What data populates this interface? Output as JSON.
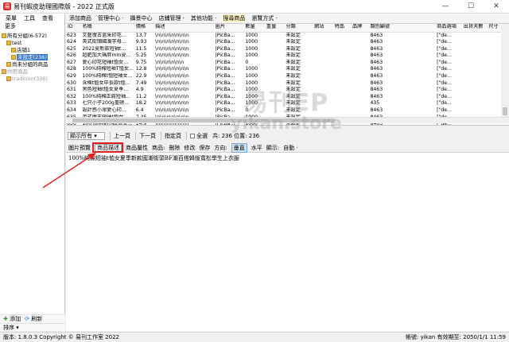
{
  "window": {
    "title": "易刊蝦皮助理國際版 - 2022 正式版",
    "app_icon": "app-logo-icon",
    "minimize": "—",
    "maximize": "☐",
    "close": "✕"
  },
  "left_panel": {
    "menu": [
      "菜單",
      "工具",
      "查看"
    ],
    "more": "更多",
    "tree": [
      {
        "label": "所有分組(6-572)",
        "level": 0,
        "style": "normal"
      },
      {
        "label": "test",
        "level": 1,
        "style": "normal"
      },
      {
        "label": "店铺1",
        "level": 2,
        "style": "normal"
      },
      {
        "label": "未設定(236)",
        "level": 2,
        "style": "sel"
      },
      {
        "label": "尚未分組的商品",
        "level": 1,
        "style": "normal"
      },
      {
        "label": "共用商品",
        "level": 0,
        "style": "gray"
      },
      {
        "label": "tradition(336)",
        "level": 1,
        "style": "gray"
      }
    ],
    "add_label": "添加",
    "refresh_label": "刷新",
    "sort_label": "排序"
  },
  "toolbar": {
    "items": [
      "添加商品",
      "管理中心 ·",
      "攝景中心",
      "店鋪管理 ·",
      "其他功能 ·",
      "搜尋商品",
      "瀏覽方式 ·"
    ]
  },
  "table": {
    "columns": [
      "ID",
      "名稱",
      "價格",
      "描述",
      "圖片",
      "數量",
      "重量",
      "分類",
      "網站",
      "特品",
      "品牌",
      "類別編號",
      "商品選項",
      "出貨天數",
      "尺寸"
    ],
    "rows": [
      [
        "623",
        "文藝復古蓝采印花...",
        "13.7",
        "\\n\\n\\n\\n\\n\\n\\n",
        "|PicBa...",
        "1000",
        "",
        "未設定",
        "",
        "",
        "",
        "8463",
        "[\"de...",
        "",
        ""
      ],
      [
        "624",
        "英式街頭國潮字母...",
        "9.93",
        "\\n\\n\\n\\n\\n\\n\\n",
        "|PicBa...",
        "1000",
        "",
        "未設定",
        "",
        "",
        "",
        "8463",
        "[\"de...",
        "",
        ""
      ],
      [
        "625",
        "2022夏新款短袖t...",
        "11.5",
        "\\n\\n\\n\\n\\n\\n\\n",
        "|PicBa...",
        "1000",
        "",
        "未設定",
        "",
        "",
        "",
        "8463",
        "[\"de...",
        "",
        ""
      ],
      [
        "626",
        "超肥加大碼胖mm夏...",
        "5.25",
        "\\n\\n\\n\\n\\n\\n\\n",
        "|PicBa...",
        "1000",
        "",
        "未設定",
        "",
        "",
        "",
        "8463",
        "[\"de...",
        "",
        ""
      ],
      [
        "627",
        "愛心印花短袖t恤女...",
        "9.75",
        "\\n\\n\\n\\n\\n\\n",
        "|PicBa...",
        "0",
        "",
        "未設定",
        "",
        "",
        "",
        "8463",
        "[\"de...",
        "",
        ""
      ],
      [
        "628",
        "100%純棉短袖T恤女...",
        "12.8",
        "\\n\\n\\n\\n\\n\\n\\n",
        "|PicBa...",
        "1000",
        "",
        "未設定",
        "",
        "",
        "",
        "8463",
        "[\"de...",
        "",
        ""
      ],
      [
        "629",
        "100%純棉t恤短袖女...",
        "22.9",
        "\\n\\n\\n\\n\\n\\n\\n",
        "|PicBa...",
        "1000",
        "",
        "未設定",
        "",
        "",
        "",
        "8463",
        "[\"de...",
        "",
        ""
      ],
      [
        "630",
        "含棉t恤女中長款t恤...",
        "7.49",
        "\\n\\n\\n\\n\\n\\n\\n",
        "|PicBa...",
        "1000",
        "",
        "未設定",
        "",
        "",
        "",
        "8463",
        "[\"de...",
        "",
        ""
      ],
      [
        "631",
        "黑色短袖t恤女夏季...",
        "4.9",
        "\\n\\n\\n\\n\\n\\n\\n",
        "|PicBa...",
        "1000",
        "",
        "未設定",
        "",
        "",
        "",
        "8463",
        "[\"de...",
        "",
        ""
      ],
      [
        "632",
        "100%純棉正肩短袖...",
        "11.2",
        "\\n\\n\\n\\n\\n\\n\\n",
        "|PicBa...",
        "1000",
        "",
        "未設定",
        "",
        "",
        "",
        "8463",
        "[\"de...",
        "",
        ""
      ],
      [
        "633",
        "七只小子200g重磅...",
        "18.2",
        "\\n\\n\\n\\n\\n\\n\\n",
        "|PicBa...",
        "1000",
        "",
        "未設定",
        "",
        "",
        "",
        "435",
        "[\"de...",
        "",
        ""
      ],
      [
        "634",
        "設計感小眾愛心印...",
        "6.4",
        "\\n\\n\\n\\n\\n\\n\\n",
        "|PicBa...",
        "0",
        "",
        "未設定",
        "",
        "",
        "",
        "8463",
        "[\"de...",
        "",
        ""
      ],
      [
        "635",
        "英式復古短袖t恤女...",
        "7.45",
        "\\n\\n\\n\\n\\n\\n\\n",
        "|PicBa...",
        "1000",
        "",
        "未設定",
        "",
        "",
        "",
        "8463",
        "[\"de...",
        "",
        ""
      ],
      [
        "636",
        "100%純棉短袖t恤女...",
        "14.9",
        "\\n\\n\\n\\n\\n\\n\\n",
        "|PicBa...",
        "1000",
        "",
        "未設定",
        "",
        "",
        "",
        "8463",
        "[\"de...",
        "",
        ""
      ]
    ]
  },
  "watermark": {
    "line1": "易刊EP",
    "line2": "yikan.store"
  },
  "pager": {
    "filter_value": "顯示所有",
    "prev": "上一頁",
    "next": "下一頁",
    "goto": "指定頁",
    "select_all": "全選",
    "summary": "共: 236 位置: 236"
  },
  "tabs": {
    "items": [
      {
        "label": "圖片預覽",
        "kind": "tab"
      },
      {
        "label": "商品描述",
        "kind": "tab-active"
      },
      {
        "label": "商品屬性",
        "kind": "tab"
      },
      {
        "label": "商品:",
        "kind": "label"
      },
      {
        "label": "刪除",
        "kind": "btn"
      },
      {
        "label": "修改",
        "kind": "btn"
      },
      {
        "label": "保存",
        "kind": "btn"
      },
      {
        "label": "方向:",
        "kind": "label"
      },
      {
        "label": "垂直",
        "kind": "btn-on"
      },
      {
        "label": "水平",
        "kind": "btn"
      },
      {
        "label": "顯示:",
        "kind": "label"
      },
      {
        "label": "自動 ·",
        "kind": "btn"
      }
    ]
  },
  "description_text": "100%純棉短袖t恤女夏季新款國潮街頭BF潮百搭韓版寬松學生上衣服",
  "status": {
    "version": "版本: 1.8.0.3 Copyright © 易刊工作室 2022",
    "account": "帳號: yikan  有效期至: 2050/1/1 11:59"
  },
  "colors": {
    "highlight_box": "#e02020",
    "arrow": "#e02020",
    "selection": "#3a78c9"
  }
}
